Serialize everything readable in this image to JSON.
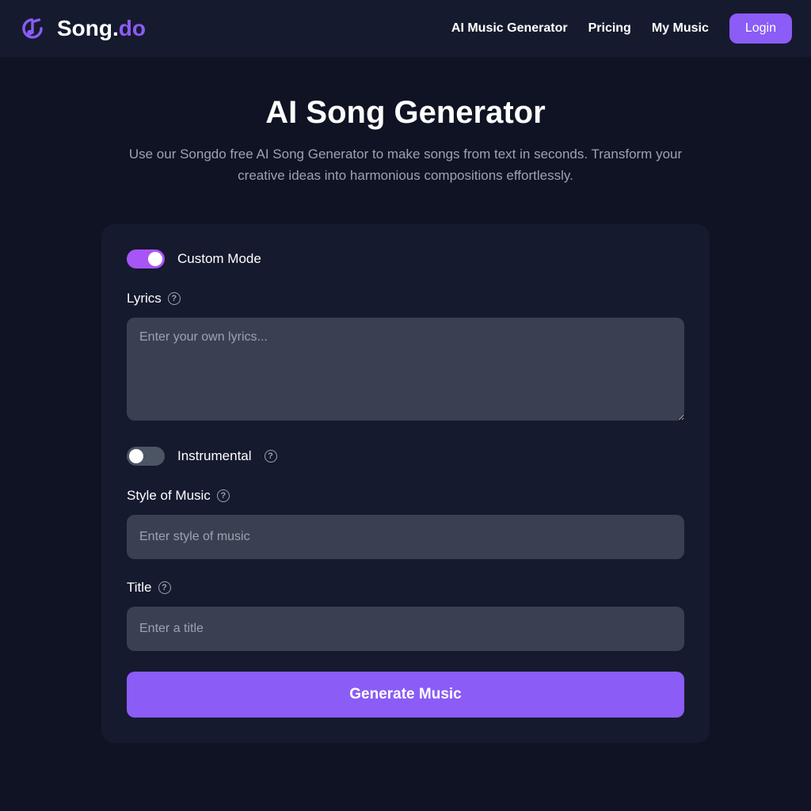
{
  "logo": {
    "name_a": "Song.",
    "name_b": "do"
  },
  "nav": {
    "items": [
      "AI Music Generator",
      "Pricing",
      "My Music"
    ],
    "login": "Login"
  },
  "hero": {
    "title": "AI Song Generator",
    "subtitle": "Use our Songdo free AI Song Generator to make songs from text in seconds. Transform your creative ideas into harmonious compositions effortlessly."
  },
  "form": {
    "custom_mode": {
      "label": "Custom Mode",
      "on": true
    },
    "lyrics": {
      "label": "Lyrics",
      "placeholder": "Enter your own lyrics..."
    },
    "instrumental": {
      "label": "Instrumental",
      "on": false
    },
    "style": {
      "label": "Style of Music",
      "placeholder": "Enter style of music"
    },
    "title": {
      "label": "Title",
      "placeholder": "Enter a title"
    },
    "generate": "Generate Music"
  },
  "colors": {
    "accent": "#8b5cf6",
    "bg": "#0f1323",
    "panel": "#161a2e"
  }
}
